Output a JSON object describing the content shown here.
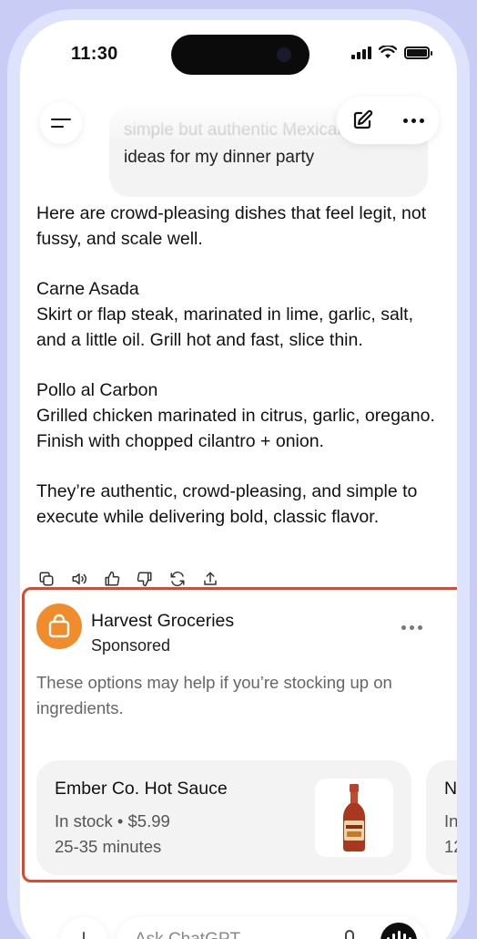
{
  "status_bar": {
    "time": "11:30"
  },
  "user_message": {
    "line1": "simple but authentic Mexican dish",
    "line2": "ideas for my dinner party"
  },
  "assistant": {
    "intro": "Here are crowd-pleasing dishes that feel legit, not fussy, and scale well.",
    "dishes": [
      {
        "name": "Carne Asada",
        "desc": "Skirt or flap steak, marinated in lime, garlic, salt, and a little oil. Grill hot and fast, slice thin."
      },
      {
        "name": "Pollo al Carbon",
        "desc": "Grilled chicken marinated in citrus, garlic, oregano. Finish with chopped cilantro + onion."
      }
    ],
    "closing": "They’re authentic, crowd-pleasing, and simple to execute while delivering bold, classic flavor."
  },
  "message_actions": [
    "copy-icon",
    "read-aloud-icon",
    "thumbs-up-icon",
    "thumbs-down-icon",
    "regenerate-icon",
    "share-icon"
  ],
  "ad": {
    "brand": "Harvest Groceries",
    "label": "Sponsored",
    "description": "These options may help if you’re stocking up on ingredients.",
    "border_color": "#e0472f",
    "logo_color": "#f08c2c",
    "products": [
      {
        "title": "Ember Co. Hot Sauce",
        "stock_price": "In stock • $5.99",
        "delivery": "25-35 minutes"
      },
      {
        "title": "N",
        "stock_price": "In",
        "delivery": "12"
      }
    ]
  },
  "composer": {
    "placeholder": "Ask ChatGPT"
  }
}
